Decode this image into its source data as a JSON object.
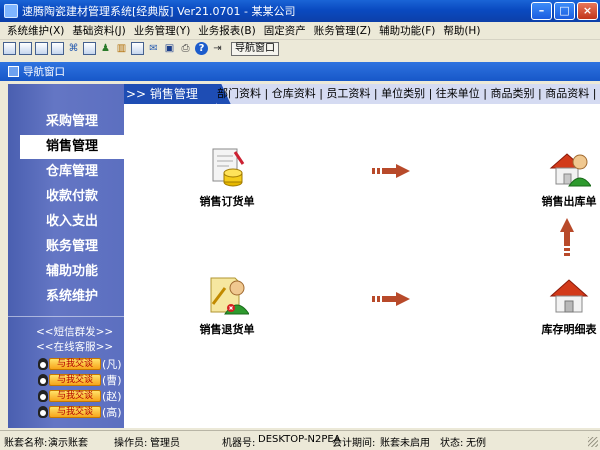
{
  "window": {
    "title": "速腾陶瓷建材管理系统[经典版] Ver21.0701  -  某某公司",
    "min_label": "–",
    "max_label": "□",
    "close_label": "×"
  },
  "menu": [
    "系统维护(X)",
    "基础资料(J)",
    "业务管理(Y)",
    "业务报表(B)",
    "固定资产",
    "账务管理(Z)",
    "辅助功能(F)",
    "帮助(H)"
  ],
  "toolbar": {
    "nav_window_label": "导航窗口"
  },
  "inner_window": {
    "title": "导航窗口"
  },
  "sidebar": {
    "items": [
      "采购管理",
      "销售管理",
      "仓库管理",
      "收款付款",
      "收入支出",
      "账务管理",
      "辅助功能",
      "系统维护"
    ],
    "active_index": 1,
    "sms_link": "<<短信群发>>",
    "cs_link": "<<在线客服>>",
    "qq_button": "与我交谈",
    "qq_contacts": [
      "(凡)",
      "(曹)",
      "(赵)",
      "(高)"
    ]
  },
  "content": {
    "section_title": ">> 销售管理",
    "quick_links": "部门资料 | 仓库资料 | 员工资料 | 单位类别 | 往来单位 | 商品类别 | 商品资料 | 结算",
    "modules": {
      "sales_order": "销售订货单",
      "sales_outbound": "销售出库单",
      "sales_return": "销售退货单",
      "inventory_detail": "库存明细表"
    }
  },
  "status": {
    "account_label": "账套名称:",
    "account_value": "演示账套",
    "operator_label": "操作员:",
    "operator_value": "管理员",
    "machine_label": "机器号:",
    "machine_value": "DESKTOP-N2PEA",
    "period_label": "会计期间:",
    "period_value": "账套未启用",
    "state_label": "状态:",
    "state_value": "无例"
  },
  "colors": {
    "titlebar": "#0A4AC0",
    "sidebar": "#5C6FC0",
    "section_head": "#1E4DB4",
    "arrow": "#B84A2A"
  }
}
